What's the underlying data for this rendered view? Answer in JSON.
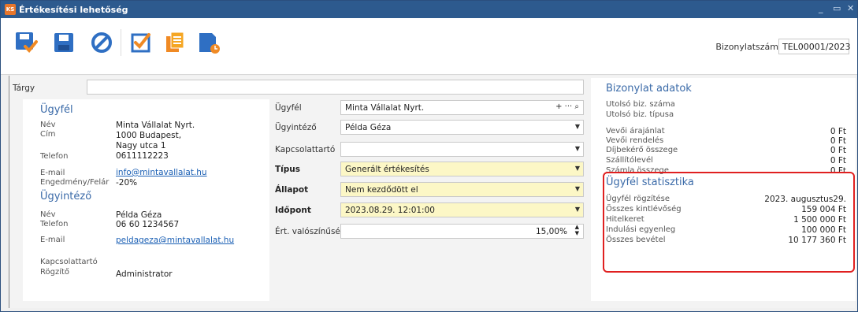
{
  "window": {
    "app_icon": "KS",
    "title": "Értékesítési lehetőség",
    "controls": [
      "_",
      "▭",
      "✕"
    ]
  },
  "toolbar": {
    "buttons": [
      {
        "name": "save-close-icon"
      },
      {
        "name": "save-icon"
      },
      {
        "name": "cancel-icon"
      },
      {
        "name": "checkbox-icon"
      },
      {
        "name": "documents-icon"
      },
      {
        "name": "history-icon"
      }
    ],
    "doc_number_label": "Bizonylatszám",
    "doc_number_value": "TEL00001/2023"
  },
  "subject": {
    "label": "Tárgy",
    "value": ""
  },
  "customer_panel": {
    "customer_title": "Ügyfél",
    "fields": {
      "name_label": "Név",
      "name_value": "Minta Vállalat Nyrt.",
      "address_label": "Cím",
      "address_line1": "1000 Budapest,",
      "address_line2": "Nagy utca 1",
      "phone_label": "Telefon",
      "phone_value": "0611112223",
      "email_label": "E-mail",
      "email_value": "info@mintavallalat.hu",
      "discount_label": "Engedmény/Felár",
      "discount_value": "-20%"
    },
    "agent_title": "Ügyintéző",
    "agent": {
      "name_label": "Név",
      "name_value": "Példa Géza",
      "phone_label": "Telefon",
      "phone_value": "06 60 1234567",
      "email_label": "E-mail",
      "email_value": "peldageza@mintavallalat.hu"
    },
    "contact_label": "Kapcsolattartó",
    "recorder_label": "Rögzítő",
    "recorder_value": "Administrator"
  },
  "form": {
    "customer_label": "Ügyfél",
    "customer_value": "Minta Vállalat Nyrt.",
    "customer_actions": "+ ··· ⌕",
    "agent_label": "Ügyintéző",
    "agent_value": "Példa Géza",
    "contact_label": "Kapcsolattartó",
    "contact_value": "",
    "type_label": "Típus",
    "type_value": "Generált értékesítés",
    "status_label": "Állapot",
    "status_value": "Nem kezdődött el",
    "time_label": "Időpont",
    "time_value": "2023.08.29. 12:01:00",
    "probability_label": "Ért. valószínűség",
    "probability_value": "15,00%"
  },
  "doc_data": {
    "title": "Bizonylat adatok",
    "last_doc_number_label": "Utolsó biz. száma",
    "last_doc_type_label": "Utolsó biz. típusa",
    "rows": [
      {
        "label": "Vevői árajánlat",
        "value": "0 Ft"
      },
      {
        "label": "Vevői rendelés",
        "value": "0 Ft"
      },
      {
        "label": "Díjbekérő összege",
        "value": "0 Ft"
      },
      {
        "label": "Szállítólevél",
        "value": "0 Ft"
      },
      {
        "label": "Számla összege",
        "value": "0 Ft"
      }
    ]
  },
  "customer_stats": {
    "title": "Ügyfél statisztika",
    "rows": [
      {
        "label": "Ügyfél rögzítése",
        "value": "2023. augusztus29."
      },
      {
        "label": "Összes kintlévőség",
        "value": "159 004 Ft"
      },
      {
        "label": "Hitelkeret",
        "value": "1 500 000 Ft"
      },
      {
        "label": "Indulási egyenleg",
        "value": "100 000 Ft"
      },
      {
        "label": "Összes bevétel",
        "value": "10 177 360 Ft"
      }
    ]
  },
  "colors": {
    "accent": "#2d5a8e",
    "highlight_border": "#e02020",
    "required_bg": "#fcf7c6"
  }
}
